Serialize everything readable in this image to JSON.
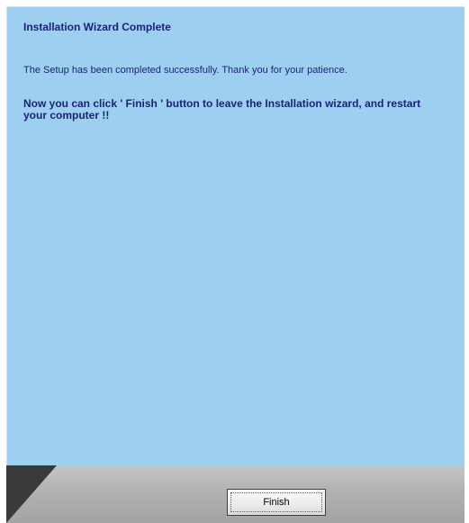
{
  "wizard": {
    "title": "Installation Wizard Complete",
    "message": "The Setup has been completed successfully. Thank you for your patience.",
    "instruction": "Now you can click ' Finish ' button to leave the Installation wizard, and restart your computer !!"
  },
  "footer": {
    "finish_label": "Finish"
  },
  "colors": {
    "panel_background": "#9dd0f0",
    "text": "#1a1f7a",
    "footer_background": "#b3b3b3",
    "corner_dark": "#3a3a3a"
  }
}
